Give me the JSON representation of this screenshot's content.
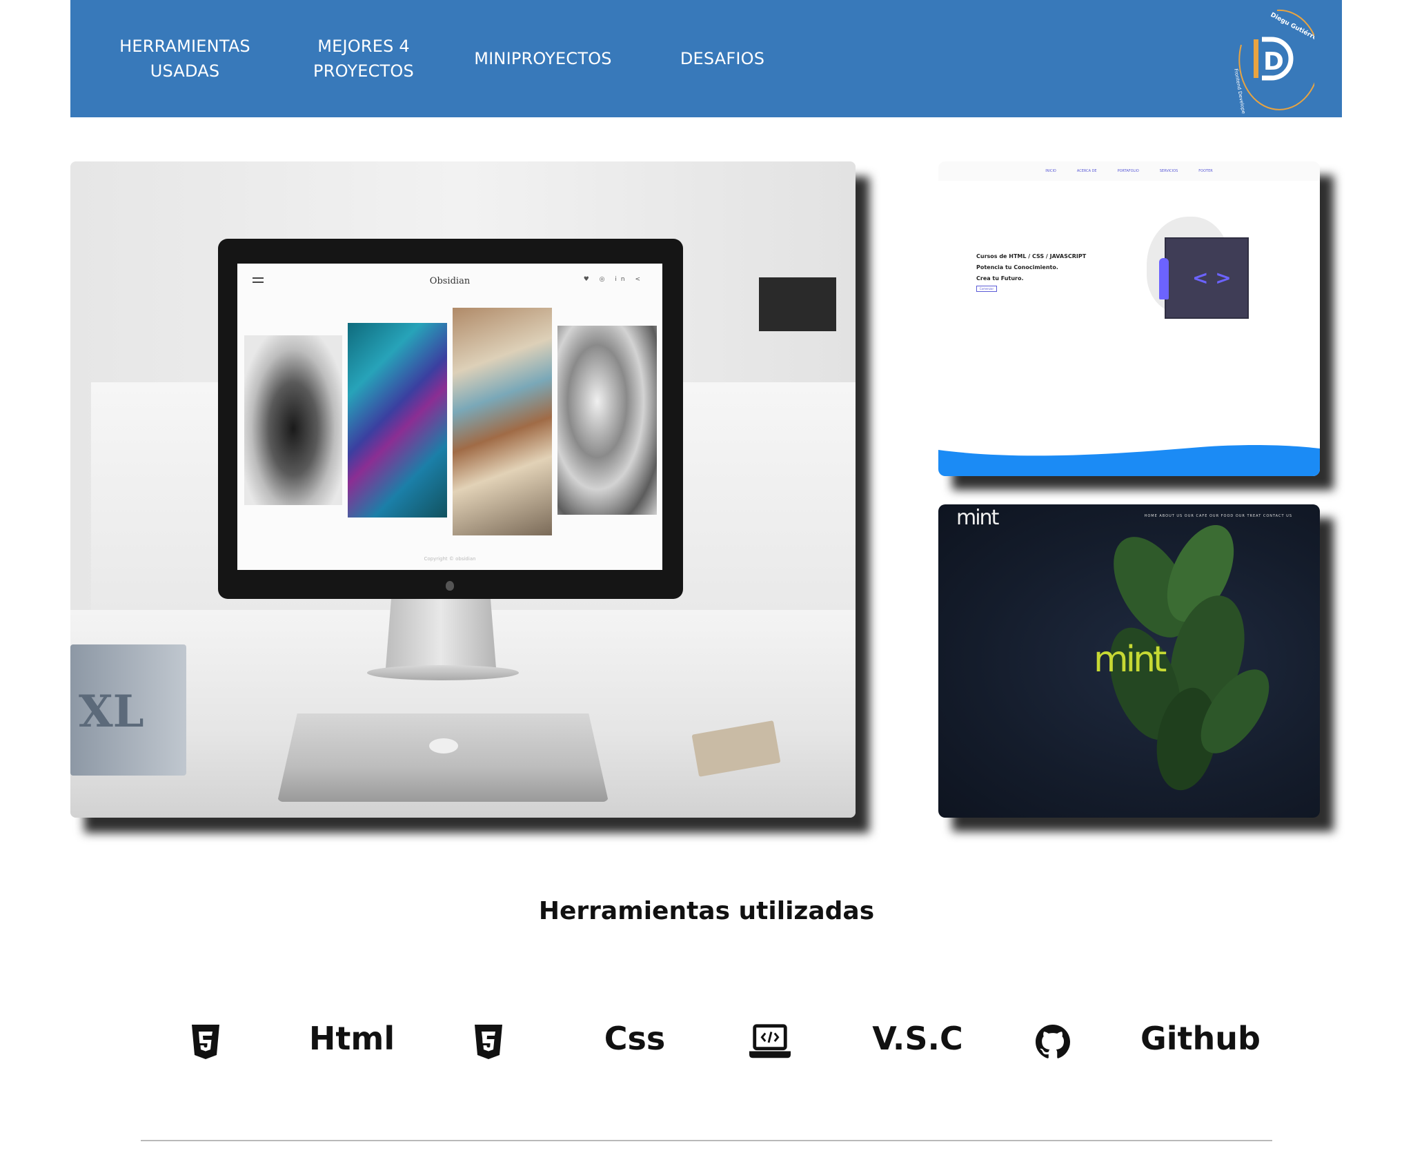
{
  "nav": {
    "items": [
      {
        "line1": "HERRAMIENTAS",
        "line2": "USADAS"
      },
      {
        "line1": "MEJORES 4",
        "line2": "PROYECTOS"
      },
      {
        "line1": "MINIPROYECTOS",
        "line2": ""
      },
      {
        "line1": "DESAFIOS",
        "line2": ""
      }
    ],
    "logo_text": "Diegu Gutiérrez",
    "logo_subtext": "Frontend Developer",
    "logo_letter": "D"
  },
  "gallery": {
    "main": {
      "screen_title": "Obsidian",
      "screen_social": "♥ ◎ in <",
      "screen_footer": "Copyright © obsidian",
      "book_text": "XL"
    },
    "course": {
      "nav_items": [
        "INICIO",
        "ACERCA DE",
        "PORTAFOLIO",
        "SERVICIOS",
        "FOOTER"
      ],
      "line1": "Cursos de HTML / CSS / JAVASCRIPT",
      "line2": "Potencia tu Conocimiento.",
      "line3": "Crea tu Futuro.",
      "button": "Comenzar",
      "code_glyph": "< >"
    },
    "mint": {
      "logo_small": "mint",
      "nav": "HOME  ABOUT US  OUR CAFE  OUR FOOD  OUR TREAT  CONTACT US",
      "logo_big": "mint"
    }
  },
  "tools": {
    "title": "Herramientas utilizadas",
    "items": [
      {
        "icon": "html5-icon",
        "label": "Html"
      },
      {
        "icon": "css3-icon",
        "label": "Css"
      },
      {
        "icon": "laptop-code-icon",
        "label": "V.S.C"
      },
      {
        "icon": "github-icon",
        "label": "Github"
      }
    ]
  },
  "colors": {
    "header_bg": "#3879ba",
    "logo_orange": "#e9a441",
    "course_wave": "#1b8bf5",
    "mint_yellow": "#c7d934"
  }
}
